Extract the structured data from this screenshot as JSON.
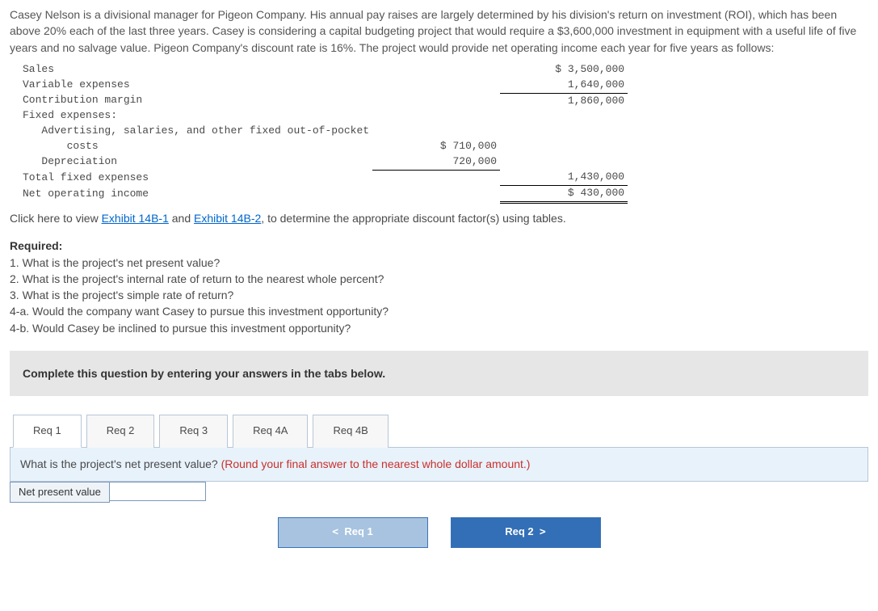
{
  "problem": {
    "text": "Casey Nelson is a divisional manager for Pigeon Company. His annual pay raises are largely determined by his division's return on investment (ROI), which has been above 20% each of the last three years. Casey is considering a capital budgeting project that would require a $3,600,000 investment in equipment with a useful life of five years and no salvage value. Pigeon Company's discount rate is 16%. The project would provide net operating income each year for five years as follows:"
  },
  "income": {
    "sales_label": "Sales",
    "sales_val": "$ 3,500,000",
    "varexp_label": "Variable expenses",
    "varexp_val": "1,640,000",
    "cm_label": "Contribution margin",
    "cm_val": "1,860,000",
    "fixed_hdr": "Fixed expenses:",
    "adv_label": "   Advertising, salaries, and other fixed out-of-pocket",
    "adv_label2": "       costs",
    "adv_val": "$ 710,000",
    "dep_label": "   Depreciation",
    "dep_val": "720,000",
    "tfe_label": "Total fixed expenses",
    "tfe_val": "1,430,000",
    "noi_label": "Net operating income",
    "noi_val": "$ 430,000"
  },
  "exhibits": {
    "pre": "Click here to view ",
    "link1": "Exhibit 14B-1",
    "mid": " and ",
    "link2": "Exhibit 14B-2",
    "post": ", to determine the appropriate discount factor(s) using tables."
  },
  "required": {
    "heading": "Required:",
    "q1": "1. What is the project's net present value?",
    "q2": "2. What is the project's internal rate of return to the nearest whole percent?",
    "q3": "3. What is the project's simple rate of return?",
    "q4a": "4-a. Would the company want Casey to pursue this investment opportunity?",
    "q4b": "4-b. Would Casey be inclined to pursue this investment opportunity?"
  },
  "instruction": "Complete this question by entering your answers in the tabs below.",
  "tabs": {
    "t1": "Req 1",
    "t2": "Req 2",
    "t3": "Req 3",
    "t4a": "Req 4A",
    "t4b": "Req 4B"
  },
  "questionBar": {
    "q": "What is the project's net present value? ",
    "hint": "(Round your final answer to the nearest whole dollar amount.)"
  },
  "answer": {
    "label": "Net present value"
  },
  "nav": {
    "prev": "Req 1",
    "next": "Req 2"
  }
}
